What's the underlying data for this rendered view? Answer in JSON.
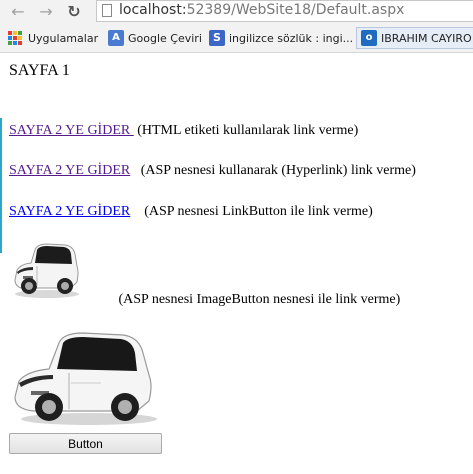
{
  "browser": {
    "url_host": "localhost:",
    "url_rest": "52389/WebSite18/Default.aspx",
    "bookmarks": [
      {
        "label": "Uygulamalar",
        "icon": "apps-grid-icon"
      },
      {
        "label": "Google Çeviri",
        "icon": "google-translate-icon"
      },
      {
        "label": "ingilizce sözlük : ingi...",
        "icon": "sozluk-icon"
      },
      {
        "label": "IBRAHIM CAYIRO",
        "icon": "outlook-icon"
      }
    ]
  },
  "page": {
    "title": "SAYFA 1",
    "links": [
      {
        "text": "SAYFA 2 YE GİDER ",
        "desc": " (HTML etiketi kullanılarak link verme)"
      },
      {
        "text": "SAYFA 2 YE GİDER",
        "desc": "   (ASP nesnesi kullanarak (Hyperlink) link verme)"
      },
      {
        "text": "SAYFA 2 YE GİDER",
        "desc": "    (ASP nesnesi LinkButton ile link verme)"
      }
    ],
    "image_button_desc": "   (ASP nesnesi ImageButton nesnesi ile link verme)",
    "button_label": "Button"
  },
  "colors": {
    "visited_link": "#551a8b",
    "link": "#0000ee",
    "accent_bar": "#2aa7c9"
  }
}
